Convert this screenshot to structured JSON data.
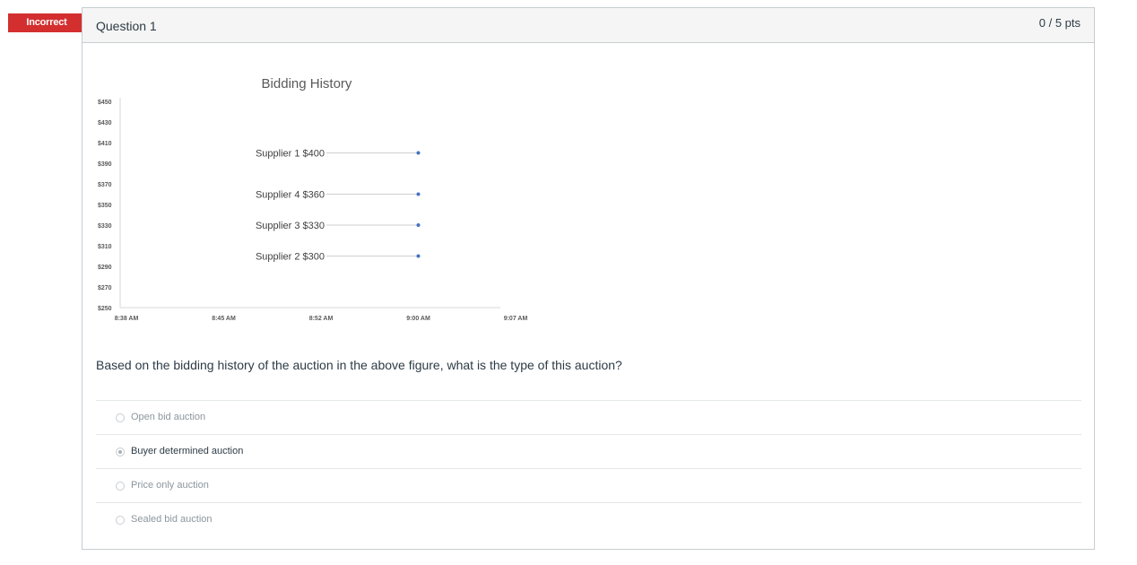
{
  "status": {
    "label": "Incorrect",
    "color": "#d32f2f"
  },
  "question": {
    "title": "Question 1",
    "points": "0 / 5 pts",
    "text": "Based on the bidding history of the auction in the above figure, what is the type of this auction?"
  },
  "answers": [
    {
      "label": "Open bid auction",
      "selected": false
    },
    {
      "label": "Buyer determined auction",
      "selected": true
    },
    {
      "label": "Price only auction",
      "selected": false
    },
    {
      "label": "Sealed bid auction",
      "selected": false
    }
  ],
  "chart_data": {
    "type": "scatter",
    "title": "Bidding History",
    "xlabel": "",
    "ylabel": "",
    "x_ticks": [
      "8:38 AM",
      "8:45 AM",
      "8:52 AM",
      "9:00 AM",
      "9:07 AM"
    ],
    "y_ticks": [
      "$450",
      "$430",
      "$410",
      "$390",
      "$370",
      "$350",
      "$330",
      "$310",
      "$290",
      "$270",
      "$250"
    ],
    "ylim": [
      250,
      450
    ],
    "xlim": [
      "8:38 AM",
      "9:07 AM"
    ],
    "grid": false,
    "series_color": "#4472c4",
    "points": [
      {
        "label": "Supplier 1  $400",
        "x": "9:00 AM",
        "y": 400
      },
      {
        "label": "Supplier 4 $360",
        "x": "9:00 AM",
        "y": 360
      },
      {
        "label": "Supplier 3 $330",
        "x": "9:00 AM",
        "y": 330
      },
      {
        "label": "Supplier 2 $300",
        "x": "9:00 AM",
        "y": 300
      }
    ]
  }
}
